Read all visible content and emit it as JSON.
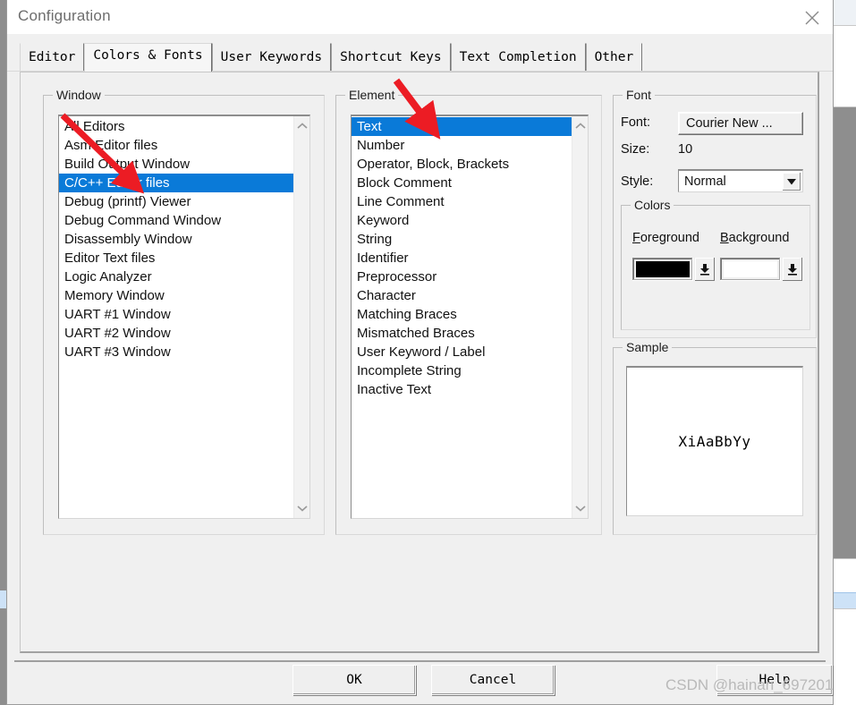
{
  "window": {
    "title": "Configuration",
    "close_icon": "close-icon"
  },
  "tabs": [
    {
      "label": "Editor",
      "active": false
    },
    {
      "label": "Colors & Fonts",
      "active": true
    },
    {
      "label": "User Keywords",
      "active": false
    },
    {
      "label": "Shortcut Keys",
      "active": false
    },
    {
      "label": "Text Completion",
      "active": false
    },
    {
      "label": "Other",
      "active": false
    }
  ],
  "window_group": {
    "title": "Window",
    "selected": "C/C++ Editor files",
    "items": [
      "All Editors",
      "Asm Editor files",
      "Build Output Window",
      "C/C++ Editor files",
      "Debug (printf) Viewer",
      "Debug Command Window",
      "Disassembly Window",
      "Editor Text files",
      "Logic Analyzer",
      "Memory Window",
      "UART #1 Window",
      "UART #2 Window",
      "UART #3 Window"
    ]
  },
  "element_group": {
    "title": "Element",
    "selected": "Text",
    "items": [
      "Text",
      "Number",
      "Operator, Block, Brackets",
      "Block Comment",
      "Line Comment",
      "Keyword",
      "String",
      "Identifier",
      "Preprocessor",
      "Character",
      "Matching Braces",
      "Mismatched Braces",
      "User Keyword / Label",
      "Incomplete String",
      "Inactive Text"
    ]
  },
  "font_group": {
    "title": "Font",
    "font_label": "Font:",
    "font_value": "Courier New ...",
    "size_label": "Size:",
    "size_value": "10",
    "style_label": "Style:",
    "style_value": "Normal",
    "style_arrow_icon": "chevron-down-icon",
    "colors": {
      "title": "Colors",
      "foreground_label": "Foreground",
      "background_label": "Background",
      "foreground_color": "#000000",
      "background_color": "#ffffff",
      "dropdown_icon": "color-dropdown-icon"
    }
  },
  "sample_group": {
    "title": "Sample",
    "text": "XiAaBbYy"
  },
  "footer": {
    "ok_label": "OK",
    "cancel_label": "Cancel",
    "help_label": "Help"
  },
  "watermark": "CSDN @hainan_697201",
  "theme": {
    "selection_blue": "#0a7ad8",
    "dialog_face": "#f0f0f0",
    "annotation_red": "#ec1c24"
  }
}
